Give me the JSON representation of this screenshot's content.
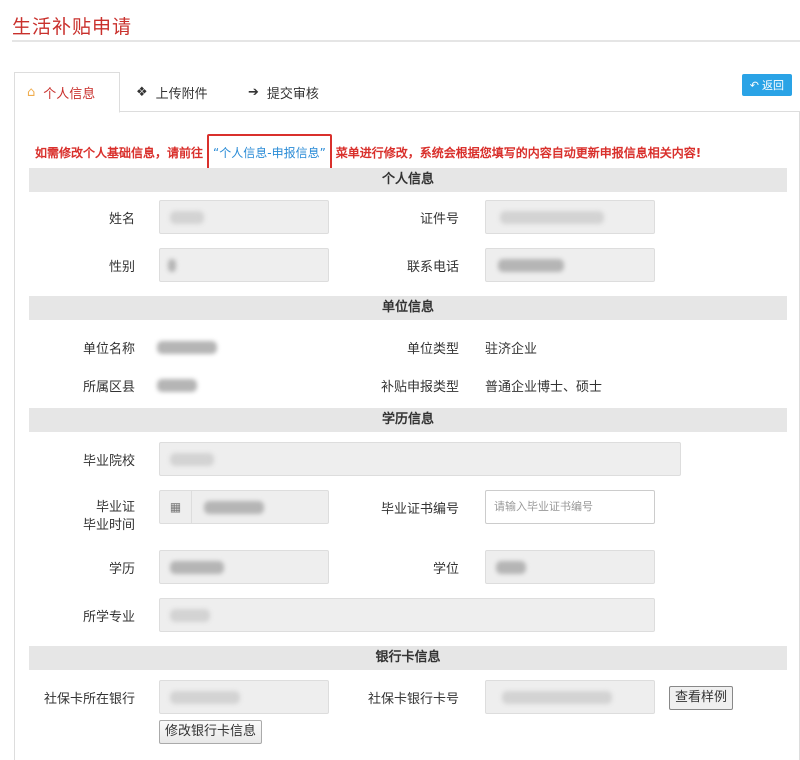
{
  "page": {
    "title": "生活补贴申请"
  },
  "tabs": [
    {
      "label": "个人信息",
      "icon": "home-icon",
      "active": true
    },
    {
      "label": "上传附件",
      "icon": "cubes-icon",
      "active": false
    },
    {
      "label": "提交审核",
      "icon": "pushpin-icon",
      "active": false
    }
  ],
  "back_button": {
    "label": "返回",
    "icon": "reply-icon"
  },
  "notice": {
    "before": "如需修改个人基础信息，请前往",
    "link": "“个人信息-申报信息”",
    "after": "菜单进行修改，系统会根据您填写的内容自动更新申报信息相关内容!"
  },
  "sections": {
    "personal": "个人信息",
    "company": "单位信息",
    "education": "学历信息",
    "bank": "银行卡信息"
  },
  "personal": {
    "name_label": "姓名",
    "id_label": "证件号",
    "gender_label": "性别",
    "phone_label": "联系电话"
  },
  "company": {
    "name_label": "单位名称",
    "type_label": "单位类型",
    "type_value": "驻济企业",
    "district_label": "所属区县",
    "subsidy_type_label": "补贴申报类型",
    "subsidy_type_value": "普通企业博士、硕士"
  },
  "education": {
    "school_label": "毕业院校",
    "cert_time_label_1": "毕业证",
    "cert_time_label_2": "毕业时间",
    "cert_no_label": "毕业证书编号",
    "cert_no_placeholder": "请输入毕业证书编号",
    "degree_label": "学历",
    "academic_degree_label": "学位",
    "major_label": "所学专业"
  },
  "bank": {
    "bank_label": "社保卡所在银行",
    "card_no_label": "社保卡银行卡号",
    "view_example_button": "查看样例",
    "modify_button": "修改银行卡信息"
  },
  "colors": {
    "accent_red": "#c9302c",
    "link_blue": "#2a8bd6",
    "back_button": "#2aa3e6"
  }
}
